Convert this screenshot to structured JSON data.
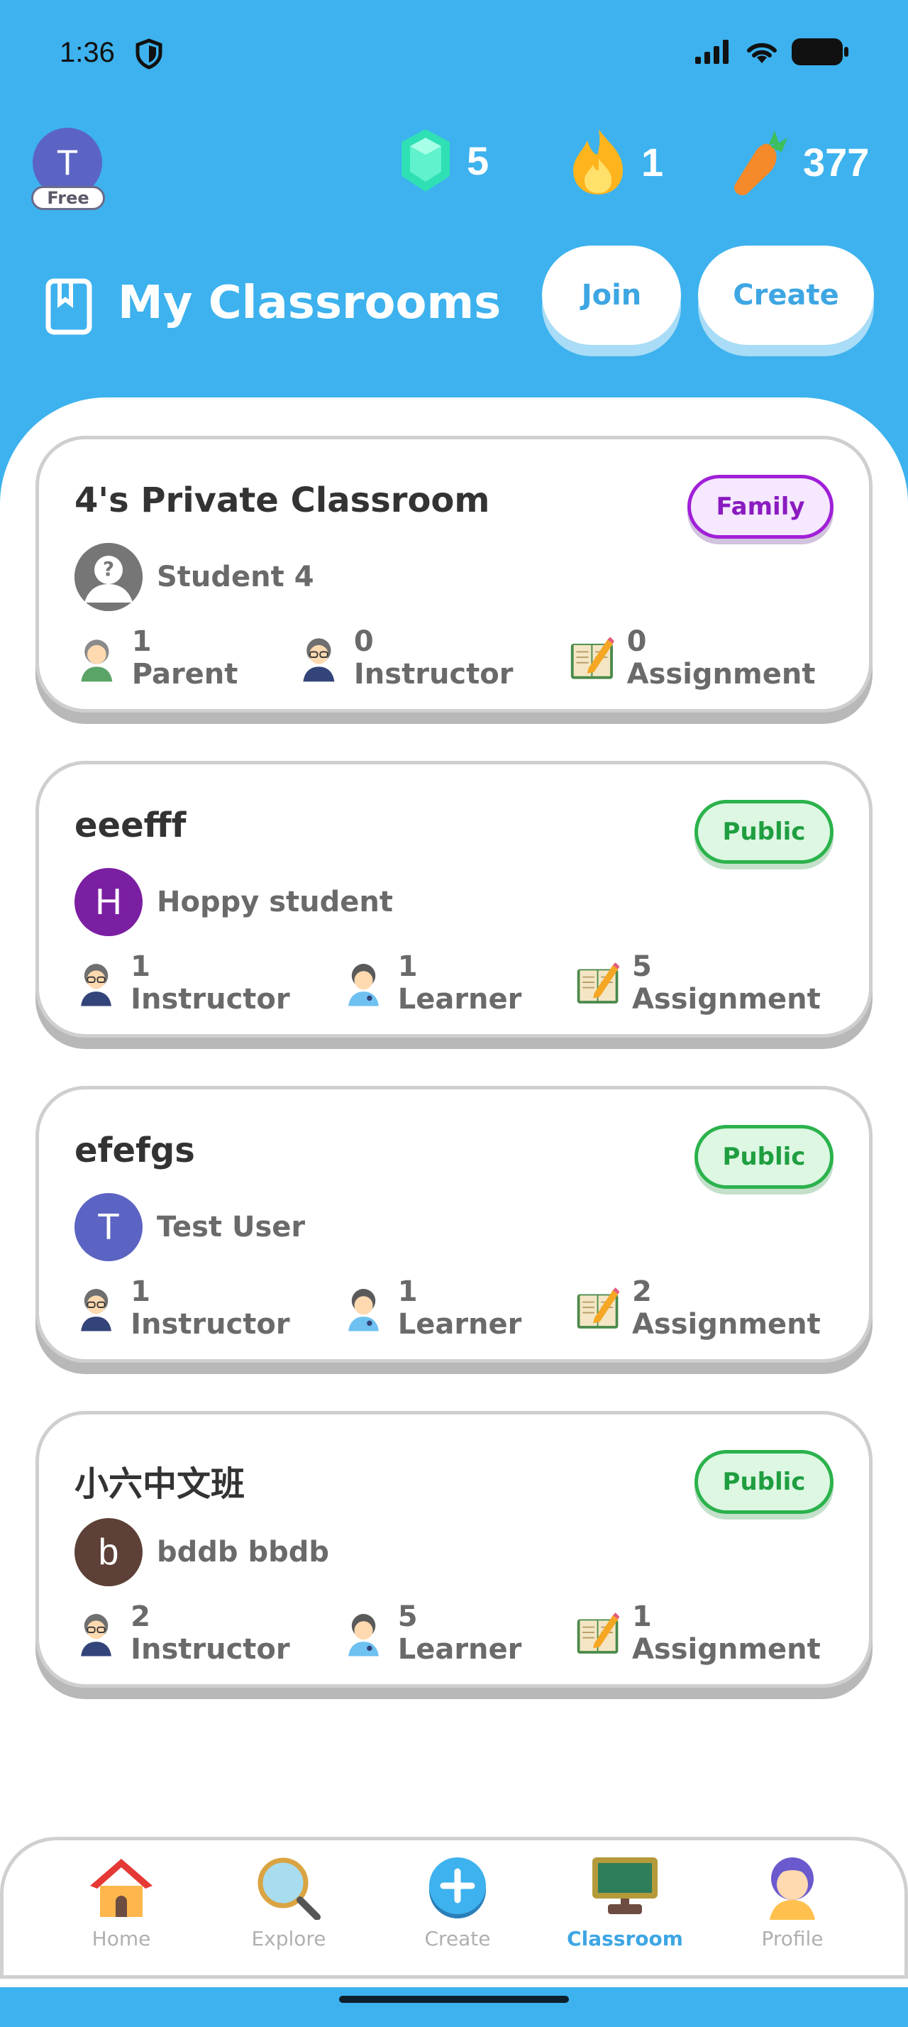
{
  "status": {
    "time": "1:36"
  },
  "user": {
    "initial": "T",
    "plan": "Free"
  },
  "stats": {
    "gems": "5",
    "streak": "1",
    "carrots": "377"
  },
  "header": {
    "title": "My Classrooms",
    "join_label": "Join",
    "create_label": "Create"
  },
  "classrooms": [
    {
      "name": "4's Private Classroom",
      "badge": "Family",
      "owner_initial": "?",
      "owner_name": "Student 4",
      "stat1": "1 Parent",
      "stat2": "0 Instructor",
      "stat3": "0 Assignment"
    },
    {
      "name": "eeefff",
      "badge": "Public",
      "owner_initial": "H",
      "owner_name": "Hoppy student",
      "stat1": "1 Instructor",
      "stat2": "1 Learner",
      "stat3": "5 Assignment"
    },
    {
      "name": "efefgs",
      "badge": "Public",
      "owner_initial": "T",
      "owner_name": "Test User",
      "stat1": "1 Instructor",
      "stat2": "1 Learner",
      "stat3": "2 Assignment"
    },
    {
      "name": "小六中文班",
      "badge": "Public",
      "owner_initial": "b",
      "owner_name": "bddb bbdb",
      "stat1": "2 Instructor",
      "stat2": "5 Learner",
      "stat3": "1 Assignment"
    }
  ],
  "nav": [
    {
      "label": "Home",
      "icon": "home-icon"
    },
    {
      "label": "Explore",
      "icon": "magnifier-icon"
    },
    {
      "label": "Create",
      "icon": "plus-icon"
    },
    {
      "label": "Classroom",
      "icon": "chalkboard-icon"
    },
    {
      "label": "Profile",
      "icon": "profile-icon"
    }
  ],
  "colors": {
    "brand": "#3db2ee",
    "family": "#a020d8",
    "public": "#2bb24c"
  }
}
